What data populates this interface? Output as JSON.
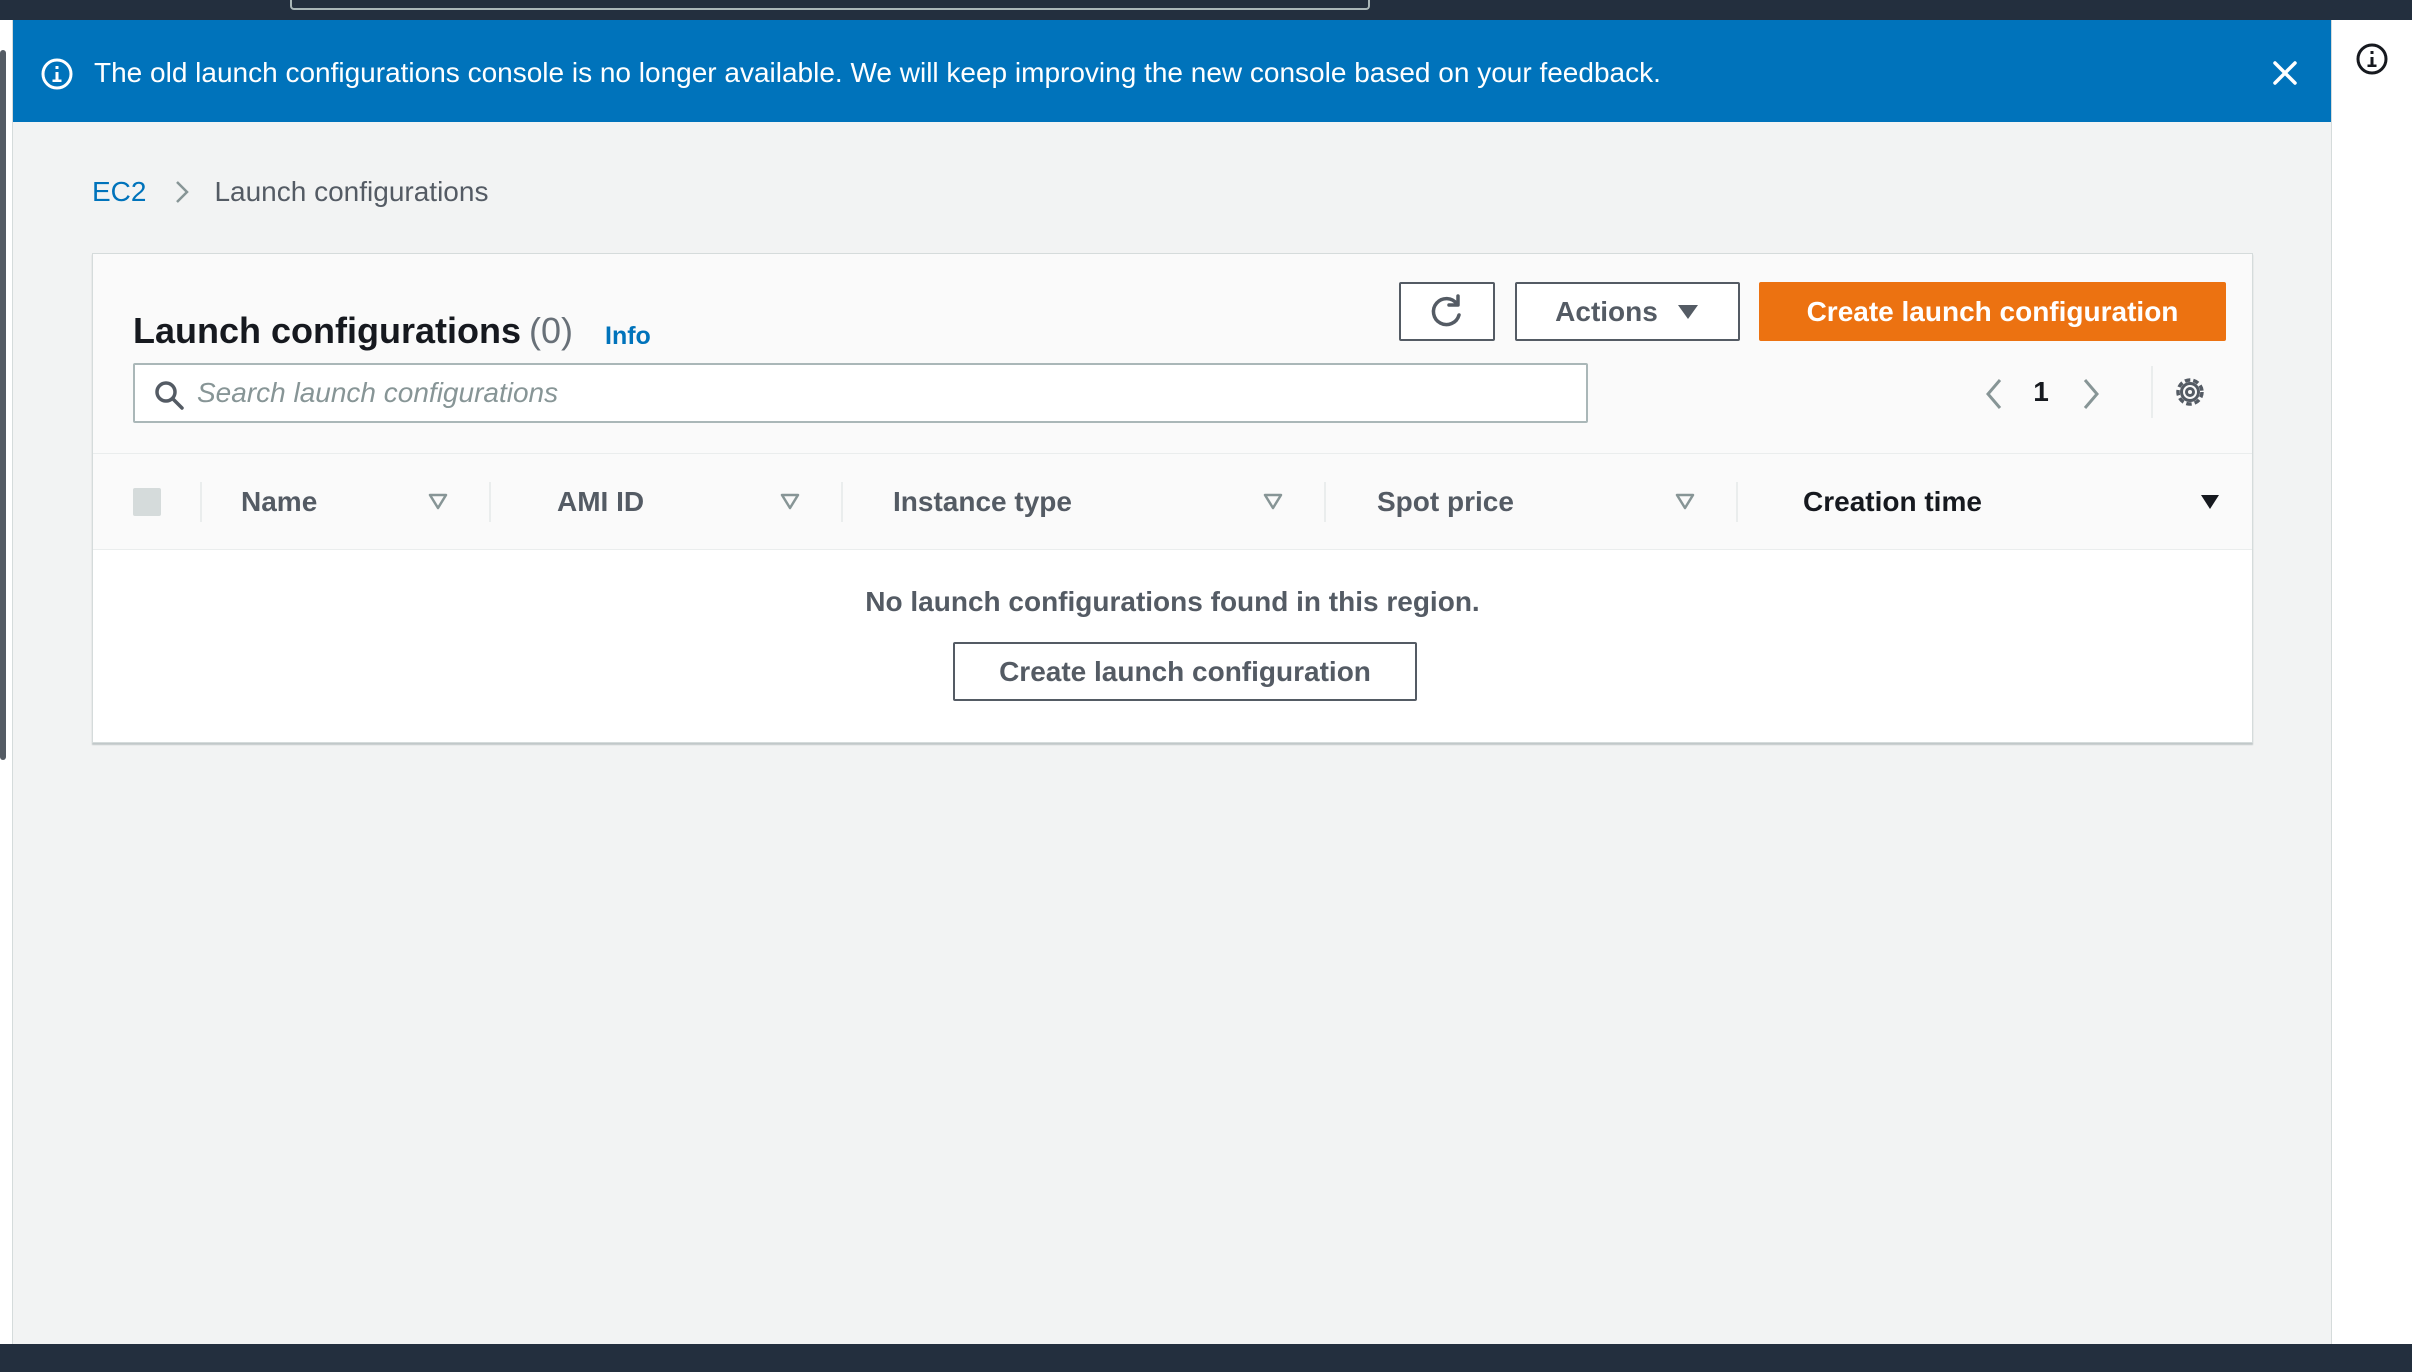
{
  "banner": {
    "message": "The old launch configurations console is no longer available. We will keep improving the new console based on your feedback.",
    "info_icon": "info-circle-icon",
    "close_icon": "close-icon"
  },
  "breadcrumb": {
    "root": "EC2",
    "separator_icon": "chevron-right-icon",
    "current": "Launch configurations"
  },
  "panel": {
    "title": "Launch configurations",
    "count": "(0)",
    "info_label": "Info",
    "refresh_icon": "refresh-icon",
    "actions_label": "Actions",
    "create_label": "Create launch configuration"
  },
  "search": {
    "placeholder": "Search launch configurations"
  },
  "pagination": {
    "current_page": "1"
  },
  "table": {
    "columns": [
      "Name",
      "AMI ID",
      "Instance type",
      "Spot price",
      "Creation time"
    ],
    "sorted_column": "Creation time",
    "rows": [],
    "empty_message": "No launch configurations found in this region.",
    "empty_action_label": "Create launch configuration"
  },
  "colors": {
    "banner_bg": "#0073bb",
    "primary_button": "#ec7211",
    "link": "#0073bb",
    "nav_dark": "#232f3e",
    "page_bg": "#f2f3f3"
  }
}
